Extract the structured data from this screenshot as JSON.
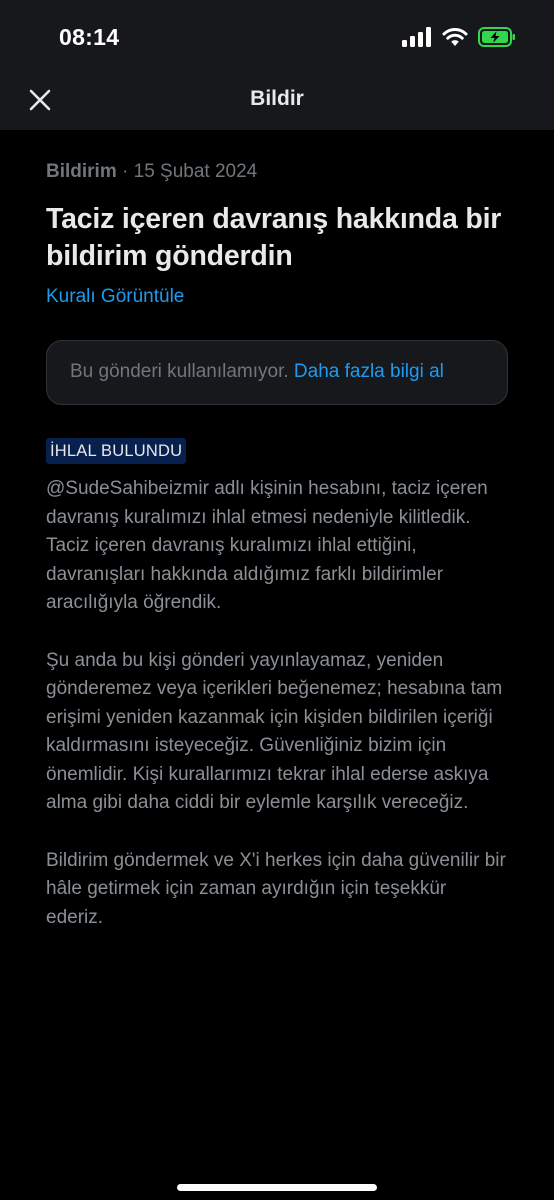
{
  "status_bar": {
    "time": "08:14",
    "icons": [
      "cellular-signal-icon",
      "wifi-icon",
      "battery-charging-icon"
    ],
    "battery_color": "#32d74b"
  },
  "nav": {
    "title": "Bildir",
    "close_icon": "close-icon"
  },
  "report": {
    "type": "Bildirim",
    "separator": " · ",
    "date": "15 Şubat 2024",
    "headline": "Taciz içeren davranış hakkında bir bildirim gönderdin",
    "rule_link": "Kuralı Görüntüle",
    "unavailable_text": "Bu gönderi kullanılamıyor. ",
    "unavailable_link": "Daha fazla bilgi al",
    "badge": "İHLAL BULUNDU",
    "paragraphs": [
      "@SudeSahibeizmir adlı kişinin hesabını, taciz içeren davranış kuralımızı ihlal etmesi nedeniyle kilitledik. Taciz içeren davranış kuralımızı ihlal ettiğini, davranışları hakkında aldığımız farklı bildirimler aracılığıyla öğrendik.",
      "Şu anda bu kişi gönderi yayınlayamaz, yeniden gönderemez veya içerikleri beğenemez; hesabına tam erişimi yeniden kazanmak için kişiden bildirilen içeriği kaldırmasını isteyeceğiz. Güvenliğiniz bizim için önemlidir. Kişi kurallarımızı tekrar ihlal ederse askıya alma gibi daha ciddi bir eylemle karşılık vereceğiz.",
      "Bildirim göndermek ve X'i herkes için daha güvenilir bir hâle getirmek için zaman ayırdığın için teşekkür ederiz."
    ]
  },
  "colors": {
    "background": "#000000",
    "header_background": "#16181c",
    "text_primary": "#e7e9ea",
    "text_secondary": "#71767b",
    "link": "#1d9bf0",
    "badge_background": "#07204d"
  }
}
